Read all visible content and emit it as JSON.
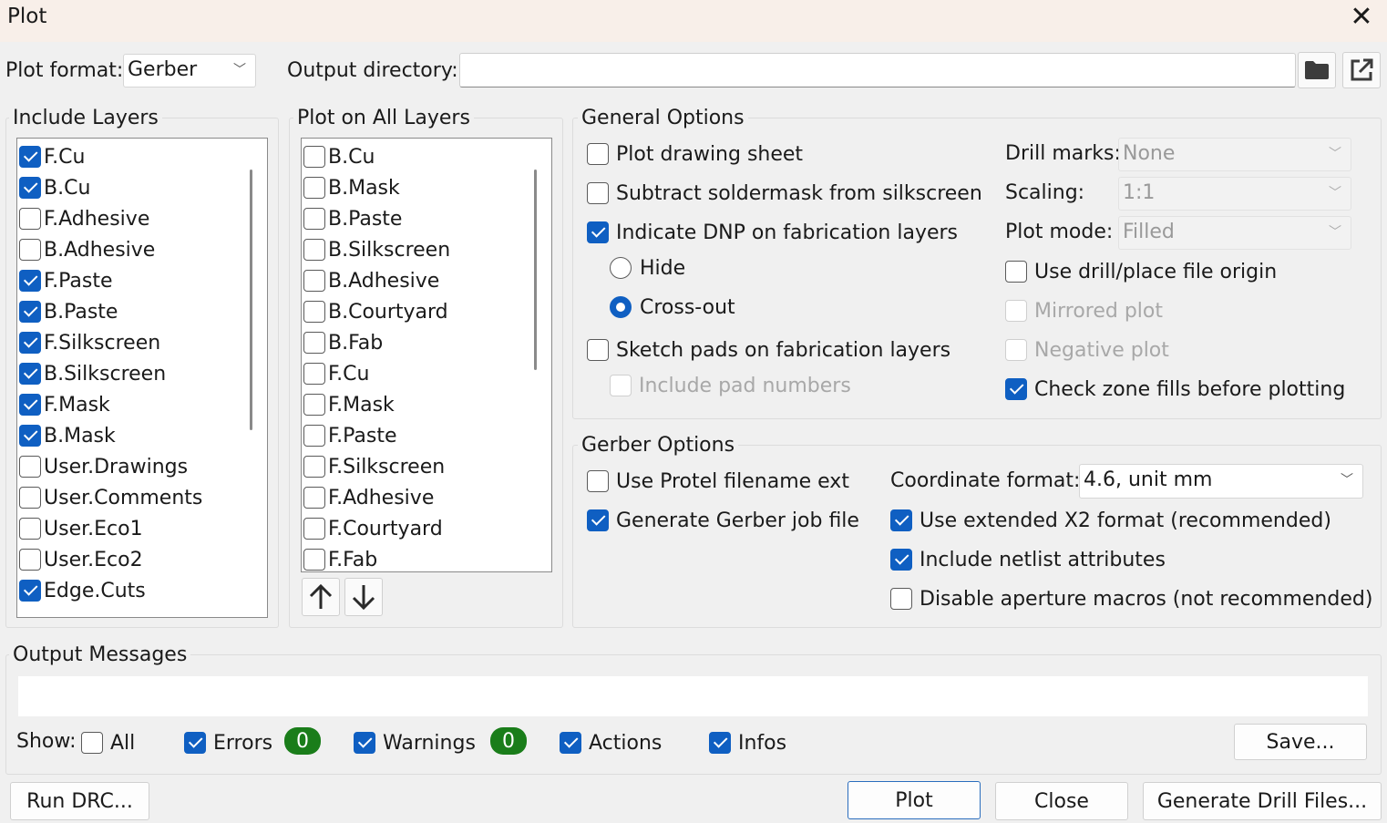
{
  "window": {
    "title": "Plot"
  },
  "top": {
    "plot_format_label": "Plot format:",
    "plot_format_value": "Gerber",
    "output_dir_label": "Output directory:",
    "output_dir_value": ""
  },
  "include_layers": {
    "title": "Include Layers",
    "items": [
      {
        "label": "F.Cu",
        "checked": true
      },
      {
        "label": "B.Cu",
        "checked": true
      },
      {
        "label": "F.Adhesive",
        "checked": false
      },
      {
        "label": "B.Adhesive",
        "checked": false
      },
      {
        "label": "F.Paste",
        "checked": true
      },
      {
        "label": "B.Paste",
        "checked": true
      },
      {
        "label": "F.Silkscreen",
        "checked": true
      },
      {
        "label": "B.Silkscreen",
        "checked": true
      },
      {
        "label": "F.Mask",
        "checked": true
      },
      {
        "label": "B.Mask",
        "checked": true
      },
      {
        "label": "User.Drawings",
        "checked": false
      },
      {
        "label": "User.Comments",
        "checked": false
      },
      {
        "label": "User.Eco1",
        "checked": false
      },
      {
        "label": "User.Eco2",
        "checked": false
      },
      {
        "label": "Edge.Cuts",
        "checked": true
      }
    ]
  },
  "plot_all_layers": {
    "title": "Plot on All Layers",
    "items": [
      {
        "label": "B.Cu",
        "checked": false
      },
      {
        "label": "B.Mask",
        "checked": false
      },
      {
        "label": "B.Paste",
        "checked": false
      },
      {
        "label": "B.Silkscreen",
        "checked": false
      },
      {
        "label": "B.Adhesive",
        "checked": false
      },
      {
        "label": "B.Courtyard",
        "checked": false
      },
      {
        "label": "B.Fab",
        "checked": false
      },
      {
        "label": "F.Cu",
        "checked": false
      },
      {
        "label": "F.Mask",
        "checked": false
      },
      {
        "label": "F.Paste",
        "checked": false
      },
      {
        "label": "F.Silkscreen",
        "checked": false
      },
      {
        "label": "F.Adhesive",
        "checked": false
      },
      {
        "label": "F.Courtyard",
        "checked": false
      },
      {
        "label": "F.Fab",
        "checked": false
      }
    ]
  },
  "general_options": {
    "title": "General Options",
    "plot_drawing_sheet": "Plot drawing sheet",
    "subtract_soldermask": "Subtract soldermask from silkscreen",
    "indicate_dnp": "Indicate DNP on fabrication layers",
    "hide": "Hide",
    "cross_out": "Cross-out",
    "sketch_pads": "Sketch pads on fabrication layers",
    "include_pad_numbers": "Include pad numbers",
    "drill_marks_label": "Drill marks:",
    "drill_marks_value": "None",
    "scaling_label": "Scaling:",
    "scaling_value": "1:1",
    "plot_mode_label": "Plot mode:",
    "plot_mode_value": "Filled",
    "use_drill_origin": "Use drill/place file origin",
    "mirrored_plot": "Mirrored plot",
    "negative_plot": "Negative plot",
    "check_zone_fills": "Check zone fills before plotting"
  },
  "gerber_options": {
    "title": "Gerber Options",
    "protel_ext": "Use Protel filename ext",
    "job_file": "Generate Gerber job file",
    "coord_format_label": "Coordinate format:",
    "coord_format_value": "4.6, unit mm",
    "x2_format": "Use extended X2 format (recommended)",
    "netlist_attrs": "Include netlist attributes",
    "disable_macros": "Disable aperture macros (not recommended)"
  },
  "output_messages": {
    "title": "Output Messages",
    "show_label": "Show:",
    "all": "All",
    "errors": "Errors",
    "errors_count": "0",
    "warnings": "Warnings",
    "warnings_count": "0",
    "actions": "Actions",
    "infos": "Infos",
    "save": "Save..."
  },
  "buttons": {
    "run_drc": "Run DRC...",
    "plot": "Plot",
    "close": "Close",
    "drill": "Generate Drill Files..."
  },
  "colors": {
    "accent": "#0f5fc2",
    "badge": "#1a7d1a"
  }
}
